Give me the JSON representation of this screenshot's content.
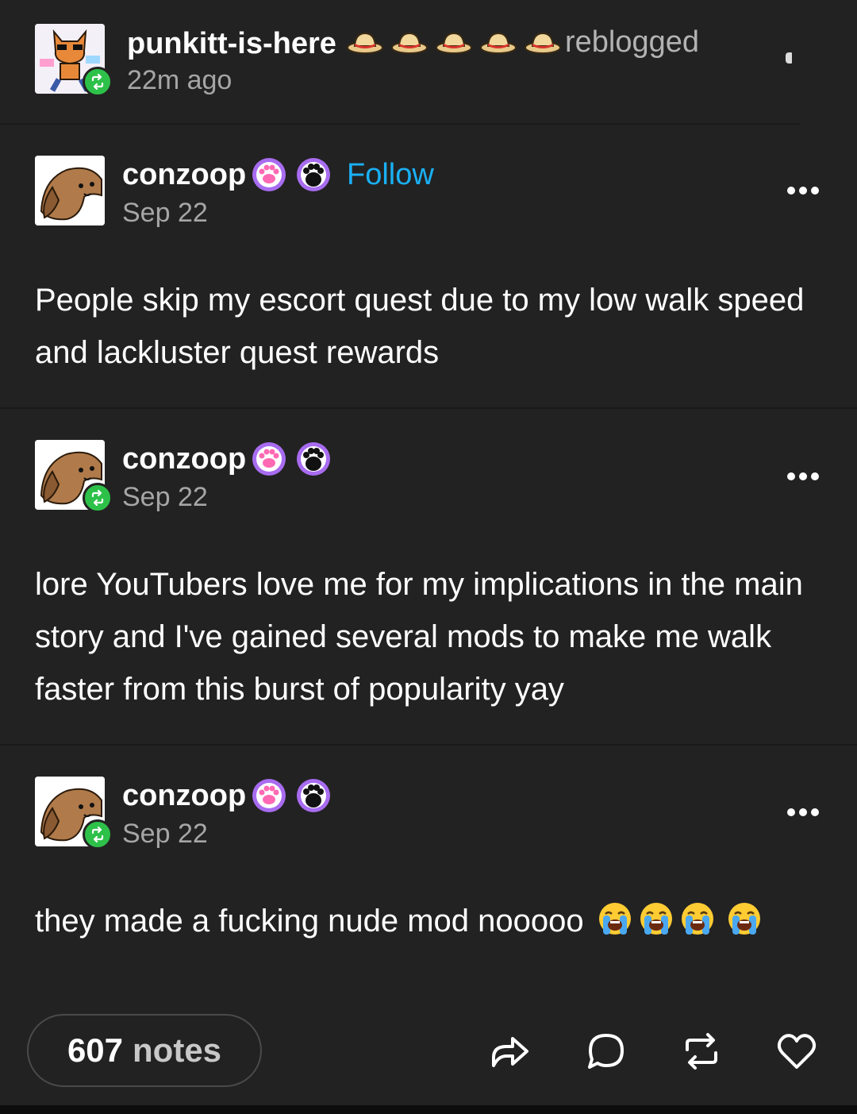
{
  "reblog": {
    "username": "punkitt-is-here",
    "badge_icons": [
      "straw-hat-icon",
      "straw-hat-icon",
      "straw-hat-icon",
      "straw-hat-icon",
      "straw-hat-icon"
    ],
    "action_text": "reblogged",
    "time": "22m ago"
  },
  "posts": [
    {
      "username": "conzoop",
      "date": "Sep 22",
      "follow_label": "Follow",
      "badge_icons": [
        "paw-badge-pink-icon",
        "paw-badge-black-icon"
      ],
      "text": "People skip my escort quest due to my low walk speed and lackluster quest rewards"
    },
    {
      "username": "conzoop",
      "date": "Sep 22",
      "badge_icons": [
        "paw-badge-pink-icon",
        "paw-badge-black-icon"
      ],
      "text": "lore YouTubers love me for my implications in the main story and I've gained several mods to make me walk faster from this burst of popularity yay"
    },
    {
      "username": "conzoop",
      "date": "Sep 22",
      "badge_icons": [
        "paw-badge-pink-icon",
        "paw-badge-black-icon"
      ],
      "text": "they made a fucking nude mod nooooo",
      "emoji": [
        "loudly-crying-face-icon",
        "loudly-crying-face-icon",
        "loudly-crying-face-icon",
        "loudly-crying-face-icon"
      ]
    }
  ],
  "footer": {
    "notes_count": "607",
    "notes_label": "notes",
    "actions": [
      "share-icon",
      "reply-icon",
      "reblog-icon",
      "like-icon"
    ]
  },
  "colors": {
    "background": "#222222",
    "follow_link": "#1ab0f5",
    "reblog_badge": "#2ec14a",
    "muted_text": "#a6a6a6"
  }
}
